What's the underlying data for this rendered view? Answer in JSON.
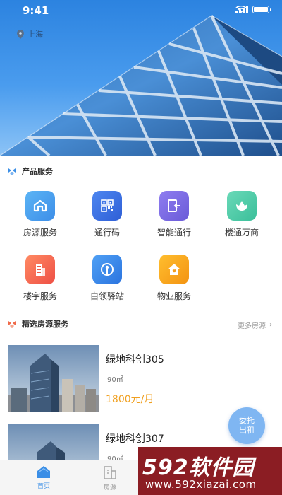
{
  "status_bar": {
    "time": "9:41"
  },
  "location": {
    "city": "上海"
  },
  "product_services": {
    "title": "产品服务",
    "items": [
      {
        "label": "房源服务",
        "icon": "house-icon",
        "color": "#4aa3f0"
      },
      {
        "label": "通行码",
        "icon": "qr-code-icon",
        "color": "#3b6fe0"
      },
      {
        "label": "智能通行",
        "icon": "smart-access-icon",
        "color": "#7a6fe6"
      },
      {
        "label": "楼通万商",
        "icon": "lotus-icon",
        "color": "#4cc9a8"
      },
      {
        "label": "楼宇服务",
        "icon": "building-icon",
        "color": "#f2624e"
      },
      {
        "label": "白领驿站",
        "icon": "station-icon",
        "color": "#3e8ef0"
      },
      {
        "label": "物业服务",
        "icon": "property-home-icon",
        "color": "#f5a418"
      }
    ]
  },
  "featured": {
    "title": "精选房源服务",
    "more_label": "更多房源",
    "listings": [
      {
        "name": "绿地科创305",
        "area": "90㎡",
        "price": "1800元/月"
      },
      {
        "name": "绿地科创307",
        "area": "90㎡",
        "price": ""
      }
    ]
  },
  "fab": {
    "line1": "委托",
    "line2": "出租"
  },
  "tabbar": {
    "tabs": [
      {
        "label": "首页",
        "active": true
      },
      {
        "label": "房源",
        "active": false
      }
    ]
  },
  "watermark": {
    "brand": "592软件园",
    "url": "www.592xiazai.com"
  }
}
